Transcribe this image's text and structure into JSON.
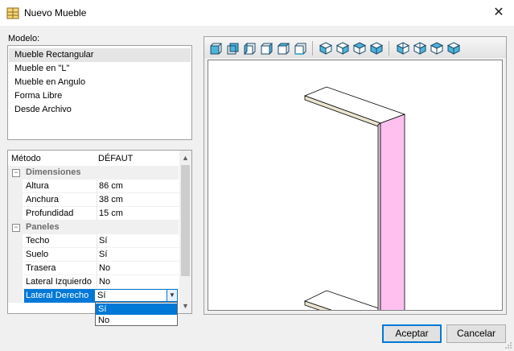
{
  "window": {
    "title": "Nuevo Mueble",
    "close_glyph": "✕"
  },
  "model": {
    "label": "Modelo:",
    "items": [
      "Mueble Rectangular",
      "Mueble en \"L\"",
      "Mueble en Angulo",
      "Forma Libre",
      "Desde Archivo"
    ],
    "selected_index": 0
  },
  "properties": {
    "header": {
      "name": "Método",
      "value": "DÉFAUT"
    },
    "categories": [
      {
        "name": "Dimensiones",
        "toggle": "⊟",
        "props": [
          {
            "name": "Altura",
            "value": "86 cm"
          },
          {
            "name": "Anchura",
            "value": "38 cm"
          },
          {
            "name": "Profundidad",
            "value": "15 cm"
          }
        ]
      },
      {
        "name": "Paneles",
        "toggle": "⊟",
        "props": [
          {
            "name": "Techo",
            "value": "Sí"
          },
          {
            "name": "Suelo",
            "value": "Sí"
          },
          {
            "name": "Trasera",
            "value": "No"
          },
          {
            "name": "Lateral Izquierdo",
            "value": "No"
          },
          {
            "name": "Lateral Derecho",
            "value": "Sí"
          }
        ]
      }
    ],
    "editing": {
      "value": "Sí",
      "options": [
        "Sí",
        "No"
      ],
      "highlighted": 0
    }
  },
  "view_toolbar": {
    "buttons": [
      "view-front-icon",
      "view-back-icon",
      "view-left-icon",
      "view-right-icon",
      "view-top-icon",
      "view-bottom-icon",
      "iso-view-1-icon",
      "iso-view-2-icon",
      "iso-view-3-icon",
      "iso-view-4-icon",
      "iso-view-5-icon",
      "iso-view-6-icon",
      "iso-view-7-icon",
      "iso-view-8-icon"
    ]
  },
  "colors": {
    "accent": "#0078d7",
    "side_panel": "#ffc0f0",
    "panel_edge": "#e8e0c8"
  },
  "buttons": {
    "accept": "Aceptar",
    "cancel": "Cancelar"
  }
}
